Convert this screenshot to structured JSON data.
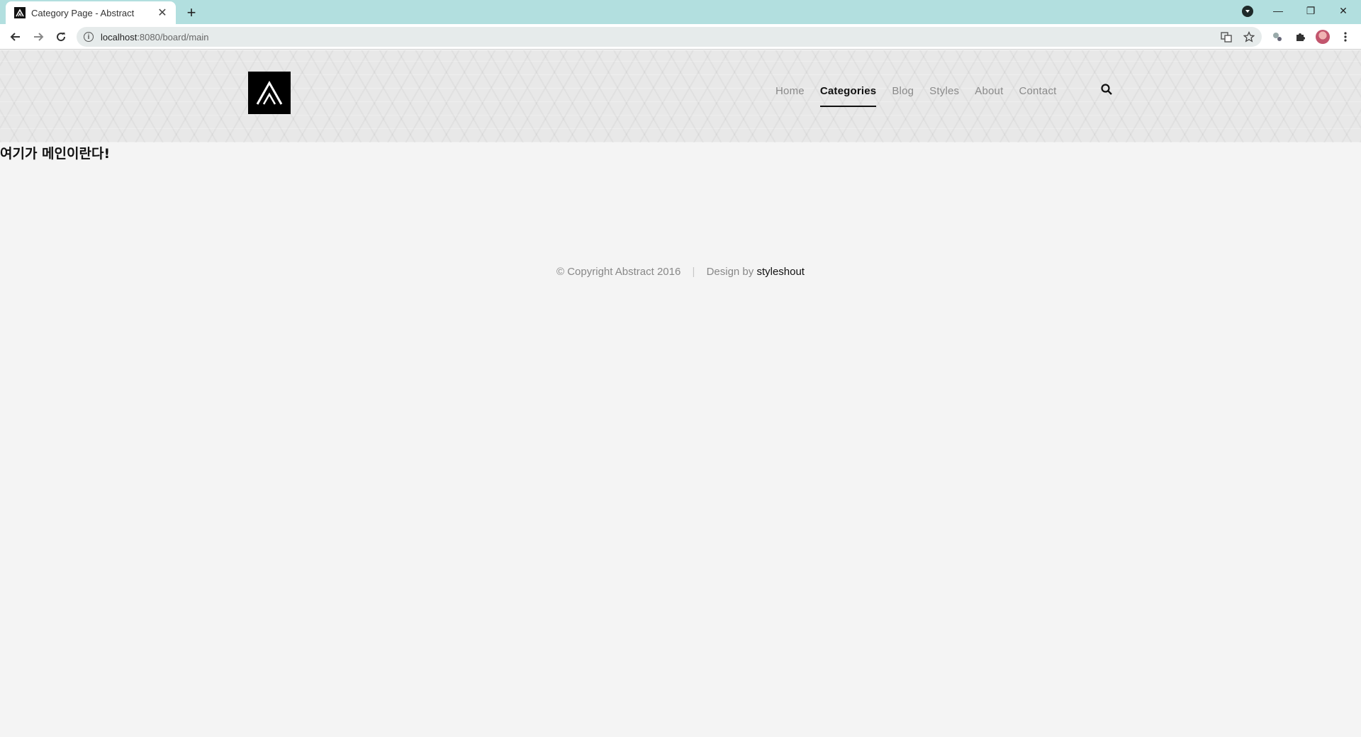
{
  "browser": {
    "tab_title": "Category Page - Abstract",
    "url_host": "localhost",
    "url_rest": ":8080/board/main"
  },
  "site": {
    "nav": [
      {
        "label": "Home"
      },
      {
        "label": "Categories",
        "active": true
      },
      {
        "label": "Blog"
      },
      {
        "label": "Styles"
      },
      {
        "label": "About"
      },
      {
        "label": "Contact"
      }
    ]
  },
  "main": {
    "heading": "여기가 메인이란다!"
  },
  "footer": {
    "copyright": "© Copyright Abstract 2016",
    "separator": "|",
    "design_prefix": "Design by",
    "design_link": "styleshout"
  },
  "icons": {
    "search": "search-icon",
    "back": "back-arrow-icon",
    "forward": "forward-arrow-icon",
    "reload": "reload-icon",
    "star": "bookmark-star-icon",
    "puzzle": "extensions-icon"
  },
  "colors": {
    "tabstrip": "#b2dfdf",
    "nav_active": "#111111",
    "nav_inactive": "#8a8a8a",
    "page_bg": "#f4f4f4"
  }
}
